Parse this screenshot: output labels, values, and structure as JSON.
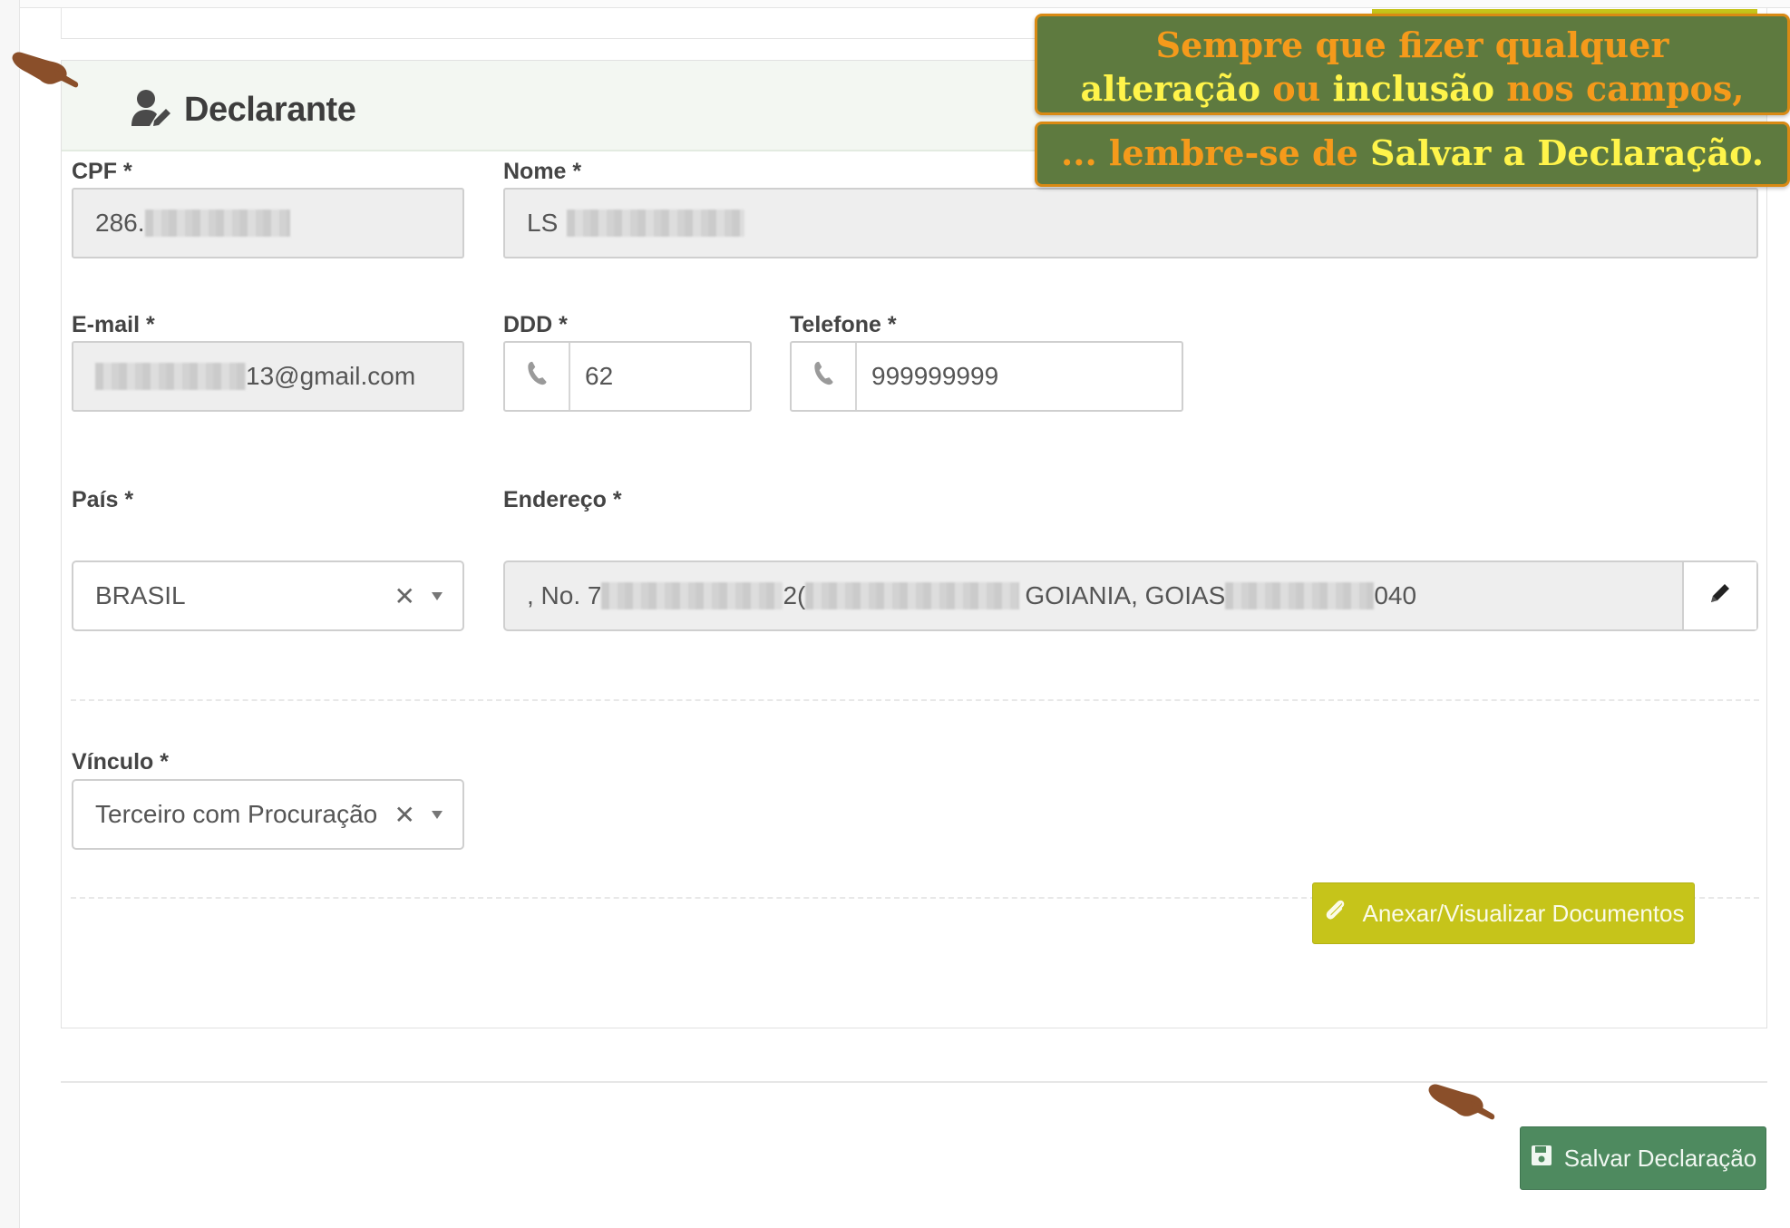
{
  "section": {
    "title": "Declarante"
  },
  "fields": {
    "cpf": {
      "label": "CPF *",
      "value": "286."
    },
    "nome": {
      "label": "Nome *",
      "value": "LS"
    },
    "email": {
      "label": "E-mail *",
      "value": "13@gmail.com"
    },
    "ddd": {
      "label": "DDD *",
      "value": "62"
    },
    "telefone": {
      "label": "Telefone *",
      "value": "999999999"
    },
    "pais": {
      "label": "País *",
      "value": "BRASIL"
    },
    "endereco": {
      "label": "Endereço *",
      "part1": ", No. 7",
      "part2": "2(",
      "part3": "GOIANIA, GOIAS",
      "part4": "040"
    },
    "vinculo": {
      "label": "Vínculo *",
      "value": "Terceiro com Procuração"
    }
  },
  "buttons": {
    "attach": "Anexar/Visualizar Documentos",
    "save": "Salvar Declaração"
  },
  "callout": {
    "line1": "Sempre que fizer qualquer",
    "line2_a": "alteração",
    "line2_b": "ou",
    "line2_c": "inclusão",
    "line2_d": "nos campos,",
    "line3_a": "... lembre-se de",
    "line3_b": "Salvar a Declaração."
  },
  "icons": {
    "title": "user-edit-icon",
    "phone": "phone-icon",
    "clear": "clear-icon",
    "caret": "chevron-down-icon",
    "pencil": "pencil-icon",
    "paperclip": "paperclip-icon",
    "save": "floppy-disk-icon",
    "pointer": "pointing-hand-icon"
  },
  "colors": {
    "attach_button": "#c6c41a",
    "save_button": "#4e8a5f",
    "callout_bg": "#5e7a3f",
    "callout_border": "#d98a14",
    "callout_orange": "#f59a1b",
    "callout_yellow": "#fff44a"
  }
}
